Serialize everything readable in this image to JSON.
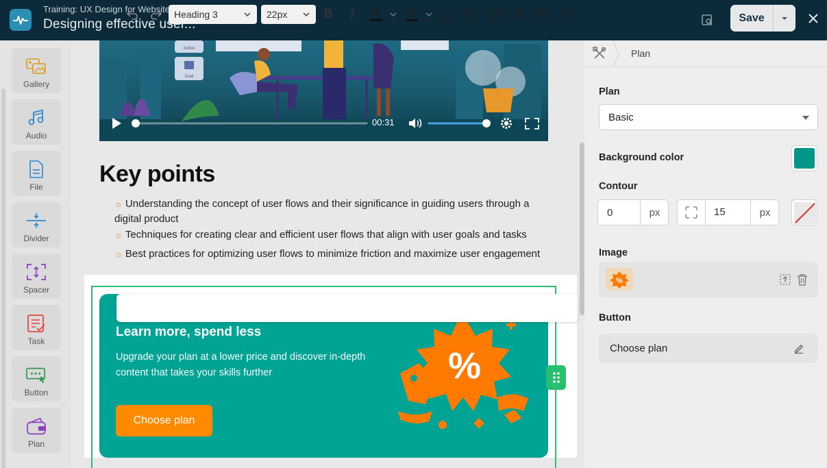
{
  "header": {
    "course_label": "Training: UX Design for Websites",
    "lesson_title": "Designing effective user...",
    "save_label": "Save"
  },
  "sidebar": {
    "items": [
      {
        "label": "Gallery",
        "icon": "gallery-icon"
      },
      {
        "label": "Audio",
        "icon": "audio-icon"
      },
      {
        "label": "File",
        "icon": "file-icon"
      },
      {
        "label": "Divider",
        "icon": "divider-icon"
      },
      {
        "label": "Spacer",
        "icon": "spacer-icon"
      },
      {
        "label": "Task",
        "icon": "task-icon"
      },
      {
        "label": "Button",
        "icon": "button-icon"
      },
      {
        "label": "Plan",
        "icon": "plan-icon"
      }
    ]
  },
  "video": {
    "time": "00:31",
    "progress": 0.0,
    "volume": 0.95,
    "thumb_labels": [
      "Action",
      "Goal"
    ]
  },
  "content": {
    "key_points_title": "Key points",
    "points": [
      "Understanding the concept of user flows and their significance in guiding users through a digital product",
      "Techniques for creating clear and efficient user flows that align with user goals and tasks",
      "Best practices for optimizing user flows to minimize friction and maximize user engagement"
    ]
  },
  "promo": {
    "title": "Learn more, spend less",
    "body": "Upgrade your plan at a lower price and discover in-depth content that takes your skills further",
    "button_label": "Choose plan",
    "background_color": "#00a394",
    "button_color": "#ff8a00"
  },
  "format_toolbar": {
    "heading_value": "Heading 3",
    "size_value": "22px"
  },
  "right_panel": {
    "breadcrumb": "Plan",
    "plan_label": "Plan",
    "plan_value": "Basic",
    "bg_color_label": "Background color",
    "bg_color_value": "#00968a",
    "contour_label": "Contour",
    "contour_width": "0",
    "contour_unit": "px",
    "contour_radius": "15",
    "radius_unit": "px",
    "image_label": "Image",
    "button_label": "Button",
    "button_value": "Choose plan"
  }
}
